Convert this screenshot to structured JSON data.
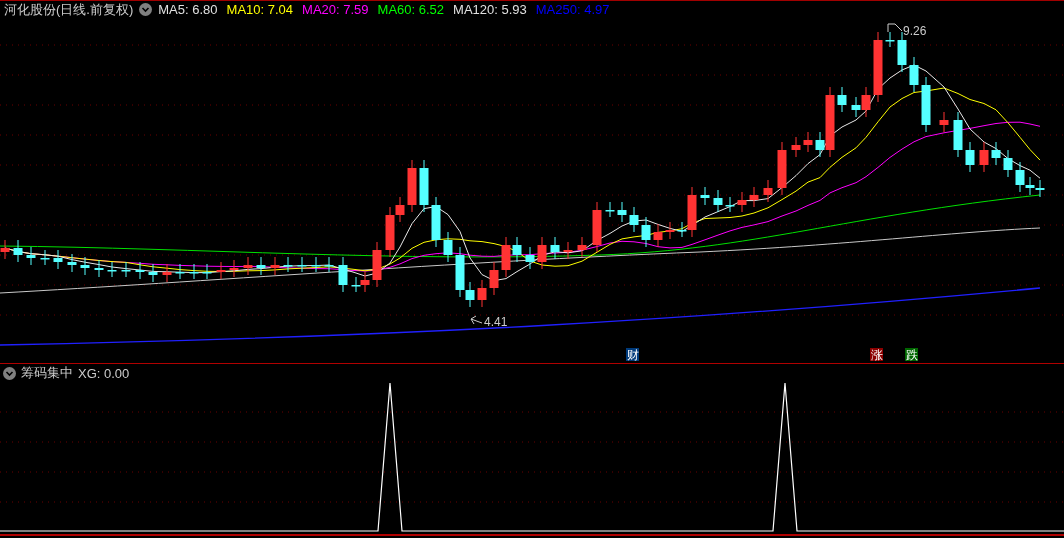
{
  "header": {
    "title": "河化股份(日线.前复权)",
    "indicators": [
      {
        "label": "MA5: 6.80",
        "color": "#e0e0e0"
      },
      {
        "label": "MA10: 7.04",
        "color": "#ffff00"
      },
      {
        "label": "MA20: 7.59",
        "color": "#ff00ff"
      },
      {
        "label": "MA60: 6.52",
        "color": "#00ff00"
      },
      {
        "label": "MA120: 5.93",
        "color": "#e0e0e0"
      },
      {
        "label": "MA250: 4.97",
        "color": "#0000ff"
      }
    ]
  },
  "price_chart": {
    "high_label": "9.26",
    "low_label": "4.41",
    "markers": [
      {
        "text": "财",
        "color": "#003a7a"
      },
      {
        "text": "涨",
        "color": "#8b0000"
      },
      {
        "text": "跌",
        "color": "#006600"
      }
    ]
  },
  "indicator_panel": {
    "title": "筹码集中",
    "reading": "XG: 0.00"
  }
}
